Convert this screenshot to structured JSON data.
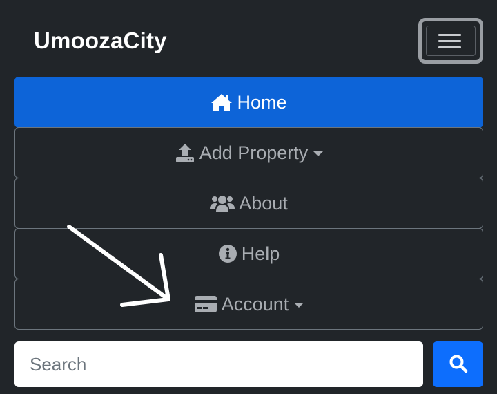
{
  "brand": {
    "name": "UmoozaCity"
  },
  "toggler": {
    "icon": "hamburger-menu-icon"
  },
  "nav": {
    "items": [
      {
        "label": "Home",
        "icon": "home-icon",
        "active": true,
        "dropdown": false
      },
      {
        "label": "Add Property",
        "icon": "upload-icon",
        "active": false,
        "dropdown": true
      },
      {
        "label": "About",
        "icon": "users-icon",
        "active": false,
        "dropdown": false
      },
      {
        "label": "Help",
        "icon": "info-circle-icon",
        "active": false,
        "dropdown": false
      },
      {
        "label": "Account",
        "icon": "credit-card-icon",
        "active": false,
        "dropdown": true
      }
    ]
  },
  "search": {
    "placeholder": "Search",
    "value": "",
    "button_icon": "search-icon"
  },
  "colors": {
    "navbar_bg": "#212529",
    "active_bg": "#0d64d8",
    "search_button_bg": "#0d6efd",
    "nav_text": "#a9adb2",
    "annotation_arrow": "#ffffff"
  },
  "annotation": {
    "type": "arrow",
    "points_to": "Account"
  }
}
